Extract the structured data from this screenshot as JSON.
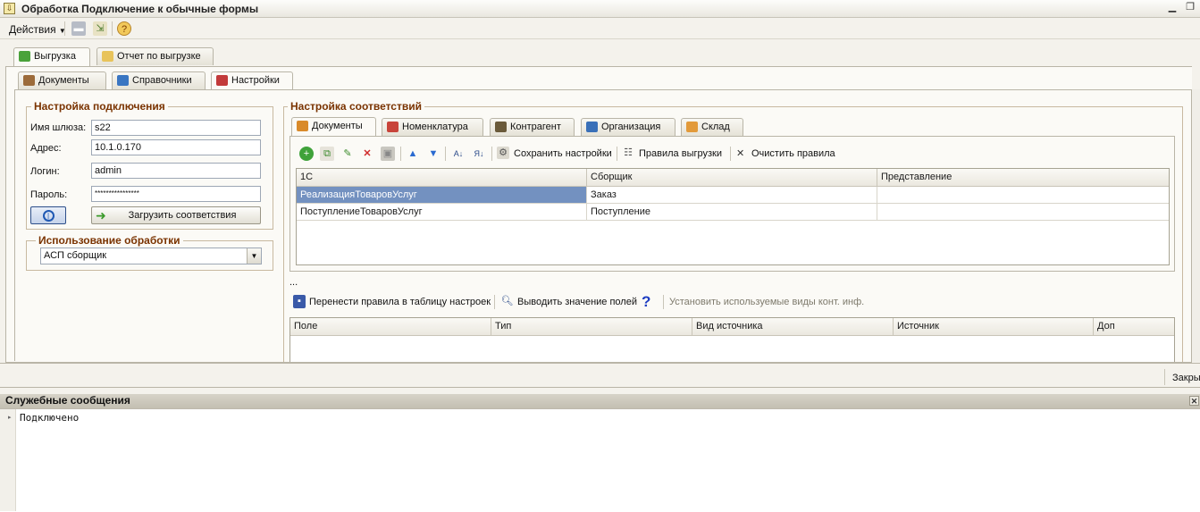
{
  "window": {
    "title": "Обработка  Подключение к обычные формы",
    "app_icon": "doc-icon"
  },
  "menu": {
    "actions_label": "Действия"
  },
  "main_tabs": [
    {
      "label": "Выгрузка",
      "active": true,
      "icon": "upload-icon"
    },
    {
      "label": "Отчет по выгрузке",
      "active": false,
      "icon": "report-icon"
    }
  ],
  "sub_tabs": [
    {
      "label": "Документы",
      "active": false,
      "icon": "briefcase-icon"
    },
    {
      "label": "Справочники",
      "active": false,
      "icon": "catalog-icon"
    },
    {
      "label": "Настройки",
      "active": true,
      "icon": "settings-icon"
    }
  ],
  "connection": {
    "group_title": "Настройка подключения",
    "gateway_label": "Имя шлюза:",
    "gateway_value": "s22",
    "address_label": "Адрес:",
    "address_value": "10.1.0.170",
    "login_label": "Логин:",
    "login_value": "admin",
    "password_label": "Пароль:",
    "password_value": "****************",
    "load_button": "Загрузить соответствия"
  },
  "usage": {
    "group_title": "Использование обработки",
    "selected": "АСП сборщик"
  },
  "mapping": {
    "group_title": "Настройка соответствий",
    "tabs": [
      {
        "label": "Документы",
        "active": true
      },
      {
        "label": "Номенклатура",
        "active": false
      },
      {
        "label": "Контрагент",
        "active": false
      },
      {
        "label": "Организация",
        "active": false
      },
      {
        "label": "Склад",
        "active": false
      }
    ],
    "toolbar": {
      "save_settings": "Сохранить настройки",
      "export_rules": "Правила выгрузки",
      "clear_rules": "Очистить правила"
    },
    "columns": [
      "1С",
      "Сборщик",
      "Представление"
    ],
    "rows": [
      {
        "c1": "РеализацияТоваровУслуг",
        "c2": "Заказ",
        "c3": "",
        "selected": true
      },
      {
        "c1": "ПоступлениеТоваровУслуг",
        "c2": "Поступление",
        "c3": "",
        "selected": false
      }
    ],
    "ellipsis": "...",
    "bottom_toolbar": {
      "move_rules": "Перенести правила в таблицу настроек",
      "show_fields": "Выводить значение полей",
      "set_contact_types": "Установить используемые виды конт. инф."
    },
    "fields_columns": [
      "Поле",
      "Тип",
      "Вид источника",
      "Источник",
      "Доп"
    ]
  },
  "footer": {
    "close_label": "Закрыть"
  },
  "messages": {
    "title": "Служебные сообщения",
    "lines": [
      "Подключено"
    ]
  }
}
